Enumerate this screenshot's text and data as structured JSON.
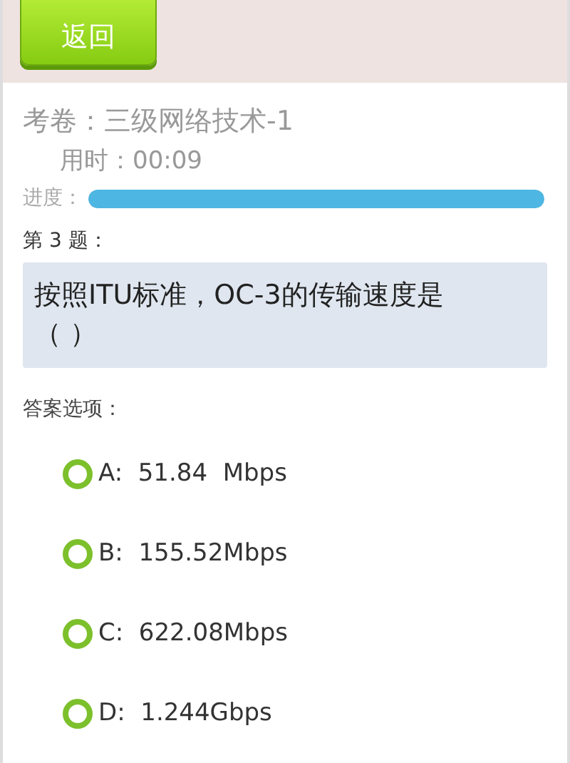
{
  "header": {
    "back_button": "返回"
  },
  "exam": {
    "paper": "考卷：三级网络技术-1",
    "time": "用时：00:09",
    "progress_label": "进度：",
    "progress": {
      "level": 1.0
    }
  },
  "question": {
    "number": "第 3 题：",
    "text": "按照ITU标准，OC-3的传输速度是（ ）"
  },
  "answers_label": "答案选项：",
  "options": [
    {
      "label": "A:  51.84  Mbps",
      "selected": false
    },
    {
      "label": "B:  155.52Mbps",
      "selected": false
    },
    {
      "label": "C:  622.08Mbps",
      "selected": false
    },
    {
      "label": "D:  1.244Gbps",
      "selected": false
    }
  ]
}
